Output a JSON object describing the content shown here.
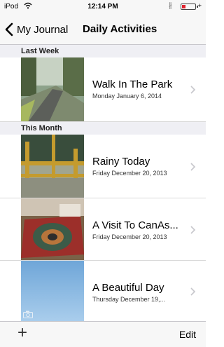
{
  "status_bar": {
    "carrier": "iPod",
    "time": "12:14 PM"
  },
  "nav": {
    "back_label": "My Journal",
    "title": "Daily Activities"
  },
  "sections": [
    {
      "header": "Last Week"
    },
    {
      "header": "This Month"
    }
  ],
  "entries": [
    {
      "title": "Walk In The Park",
      "date": "Monday January 6, 2014"
    },
    {
      "title": "Rainy Today",
      "date": "Friday December 20, 2013"
    },
    {
      "title": "A Visit To CanAs...",
      "date": "Friday December 20, 2013"
    },
    {
      "title": "A Beautiful Day",
      "date": "Thursday December 19,..."
    }
  ],
  "toolbar": {
    "add_label": "+",
    "edit_label": "Edit"
  },
  "icons": [
    "wifi-icon",
    "bluetooth-icon",
    "battery-icon",
    "back-chevron-icon",
    "chevron-right-icon",
    "camera-icon"
  ],
  "colors": {
    "battery_low": "#e0242f",
    "bar_background": "#f7f7f7",
    "section_background": "#efeff4"
  }
}
